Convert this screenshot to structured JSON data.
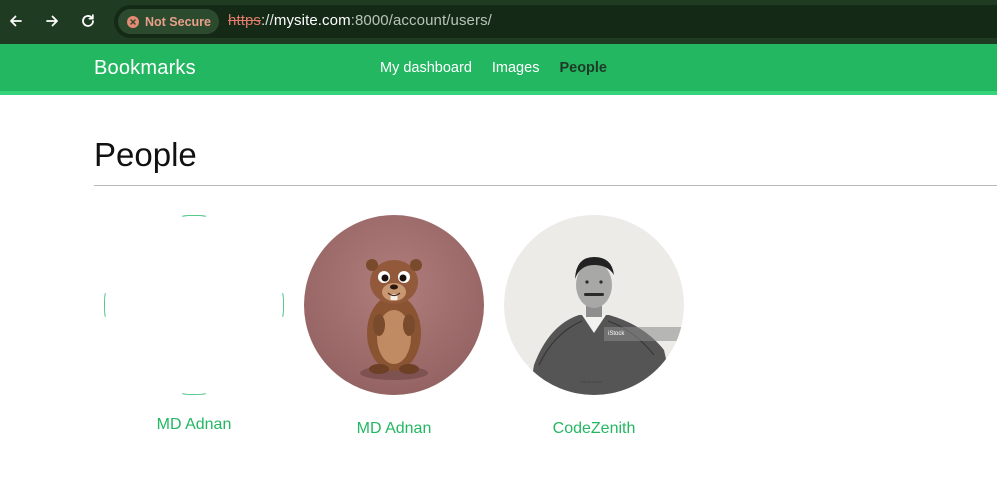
{
  "browser": {
    "security_label": "Not Secure",
    "url_scheme": "https",
    "url_sep": "://",
    "url_host": "mysite.com",
    "url_rest": ":8000/account/users/",
    "icons": [
      "back-arrow-icon",
      "forward-arrow-icon",
      "reload-icon",
      "security-warning-icon"
    ]
  },
  "site": {
    "brand": "Bookmarks",
    "nav": [
      {
        "label": "My dashboard",
        "active": false
      },
      {
        "label": "Images",
        "active": false
      },
      {
        "label": "People",
        "active": true
      }
    ],
    "accent_color": "#24b762"
  },
  "page": {
    "title": "People",
    "users": [
      {
        "name": "MD Adnan",
        "avatar": "broken-image"
      },
      {
        "name": "MD Adnan",
        "avatar": "cartoon-beaver"
      },
      {
        "name": "CodeZenith",
        "avatar": "vintage-portrait"
      }
    ]
  }
}
